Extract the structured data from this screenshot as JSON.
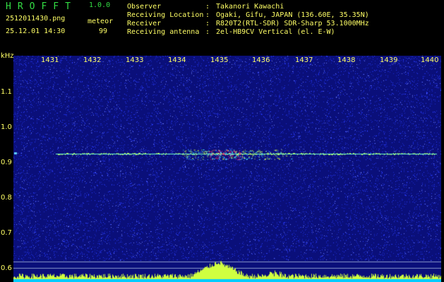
{
  "header": {
    "app_title": "HROFFT",
    "version": "1.0.0",
    "filename": "2512011430.png",
    "datetime": "25.12.01 14:30",
    "meteor_label": "meteor",
    "meteor_count": "99",
    "info": [
      {
        "label": "Observer",
        "value": "Takanori Kawachi"
      },
      {
        "label": "Receiving Location",
        "value": "Ogaki, Gifu, JAPAN (136.60E, 35.35N)"
      },
      {
        "label": "Receiver",
        "value": "R820T2(RTL-SDR) SDR-Sharp 53.1000MHz"
      },
      {
        "label": "Receiving antenna",
        "value": "2el-HB9CV Vertical (el. E-W)"
      }
    ]
  },
  "axis": {
    "y_unit": "kHz",
    "y_ticks": [
      "1.1",
      "1.0",
      "0.9",
      "0.8",
      "0.7",
      "0.6"
    ],
    "x_ticks": [
      "1431",
      "1432",
      "1433",
      "1434",
      "1435",
      "1436",
      "1437",
      "1438",
      "1439",
      "1440"
    ]
  },
  "colors": {
    "background": "#0a0f7a",
    "noise": "#2a3cff",
    "trace": "#d0ff40",
    "hot": "#ff3060",
    "text": "#ffff66",
    "title": "#33dd44"
  }
}
